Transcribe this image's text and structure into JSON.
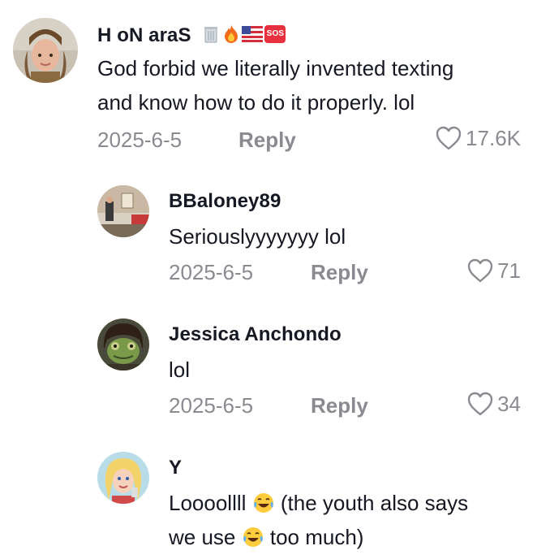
{
  "comments": [
    {
      "username": "H oN araS",
      "badges": [
        "wastebasket-emoji",
        "fire-emoji",
        "us-flag-emoji",
        "sos-emoji"
      ],
      "sos_label": "SOS",
      "text_line1": "God forbid we literally invented texting",
      "text_line2": "and know how to do it properly. lol",
      "date": "2025-6-5",
      "reply_label": "Reply",
      "likes": "17.6K"
    },
    {
      "username": "BBaloney89",
      "text_line1": "Seriouslyyyyyyy lol",
      "date": "2025-6-5",
      "reply_label": "Reply",
      "likes": "71"
    },
    {
      "username": "Jessica Anchondo",
      "text_line1": "lol",
      "date": "2025-6-5",
      "reply_label": "Reply",
      "likes": "34"
    },
    {
      "username": "Y",
      "text_line1_a": "Loooollll",
      "text_line1_b": "(the youth also says",
      "text_line2_a": "we use",
      "text_line2_b": "too much)",
      "emoji": "laughing-crying-emoji"
    }
  ],
  "colors": {
    "text": "#161823",
    "muted": "#8a8b91",
    "sos": "#e8303e"
  }
}
